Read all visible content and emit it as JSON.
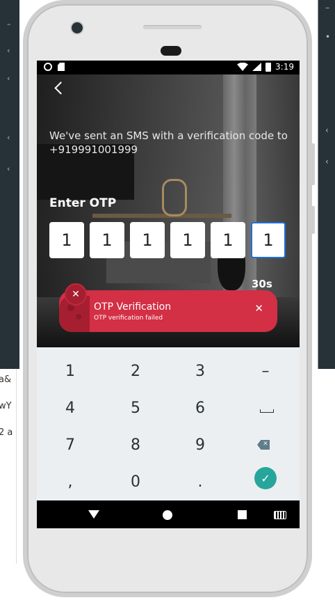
{
  "status_bar": {
    "time": "3:19"
  },
  "otp_screen": {
    "sms_message": "We've sent an SMS with a verification code to +919991001999",
    "enter_otp_label": "Enter OTP",
    "otp_digits": [
      "1",
      "1",
      "1",
      "1",
      "1",
      "1"
    ],
    "timer": "30s"
  },
  "toast": {
    "title": "OTP Verification",
    "subtitle": "OTP verification failed",
    "badge_icon": "close-icon",
    "close_icon": "close-icon",
    "color": "#d32f45"
  },
  "keyboard": {
    "keys": [
      "1",
      "2",
      "3",
      "–",
      "4",
      "5",
      "6",
      "",
      "7",
      "8",
      "9",
      "",
      ",",
      "0",
      ".",
      ""
    ],
    "enter_icon": "check-icon",
    "accent": "#26a69a"
  },
  "background": {
    "left_snippets": [
      "a&",
      "wY",
      "2 a"
    ]
  }
}
